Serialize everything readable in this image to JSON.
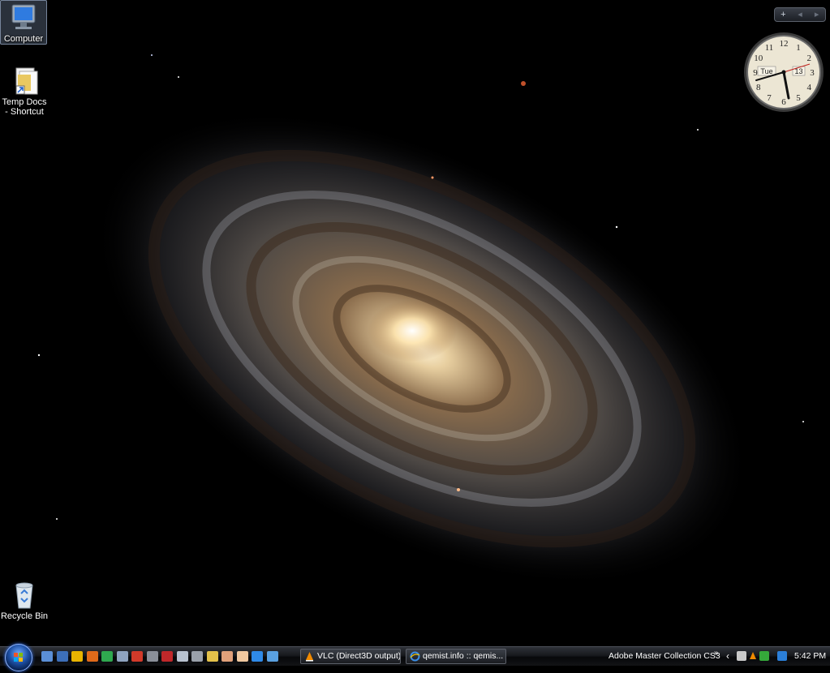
{
  "desktop": {
    "icons": [
      {
        "label": "Computer",
        "icon": "computer-icon"
      },
      {
        "label": "Temp Docs - Shortcut",
        "icon": "folder-shortcut-icon"
      },
      {
        "label": "Recycle Bin",
        "icon": "recycle-bin-icon"
      }
    ]
  },
  "gadget_bar": {
    "add": "+",
    "prev": "◂",
    "next": "▸"
  },
  "clock_gadget": {
    "day": "Tue",
    "date": "13",
    "numerals": [
      "12",
      "1",
      "2",
      "3",
      "4",
      "5",
      "6",
      "7",
      "8",
      "9",
      "10",
      "11"
    ]
  },
  "taskbar": {
    "quick_launch": [
      "show-desktop-icon",
      "switch-windows-icon",
      "media-player-icon",
      "firefox-icon",
      "h-app-icon",
      "browser-icon",
      "gmail-icon",
      "app-icon",
      "vc-icon",
      "pointer-icon",
      "calculator-icon",
      "undo-icon",
      "paint-icon",
      "hand-icon",
      "ie-icon",
      "network-icon"
    ],
    "tasks": [
      {
        "label": "VLC (Direct3D output)",
        "icon": "vlc-icon"
      },
      {
        "label": "qemist.info :: qemis...",
        "icon": "ie-icon"
      }
    ],
    "toolbar_label": "Adobe Master Collection CS3",
    "toolbar_chevron": "»",
    "tray_expand": "‹",
    "time": "5:42 PM"
  },
  "colors": {
    "taskbar": "#17191d",
    "start_orb": "#1d4fa3",
    "selection": "#7f8ca6"
  }
}
